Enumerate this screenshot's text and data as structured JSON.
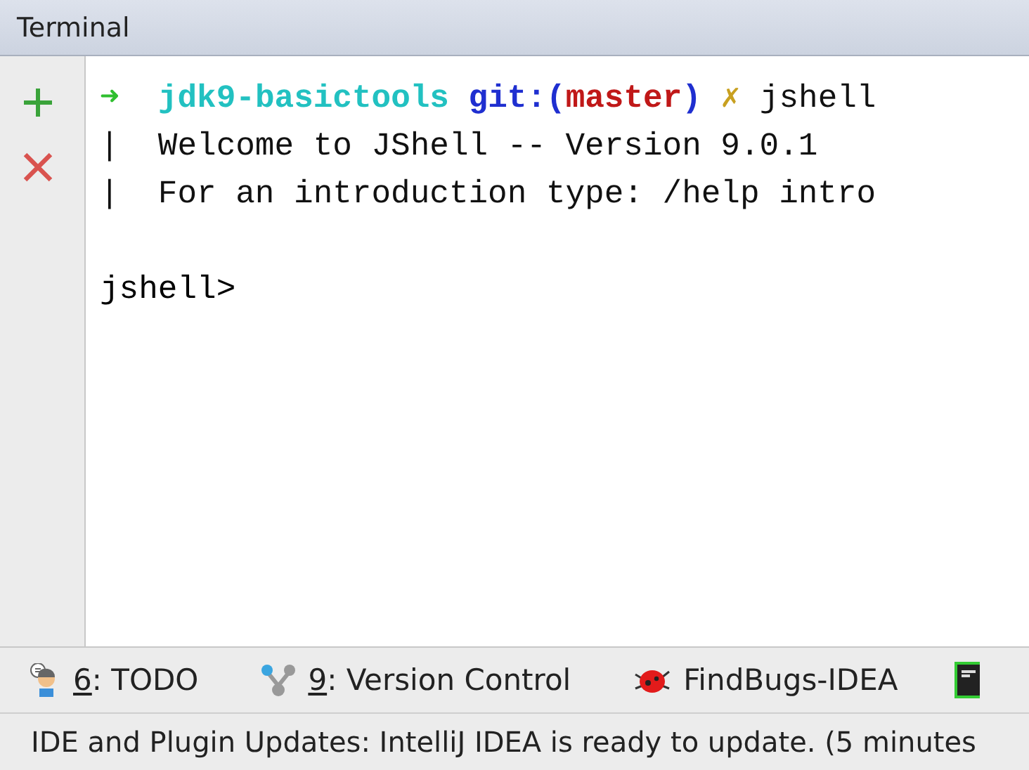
{
  "panel": {
    "title": "Terminal"
  },
  "terminal": {
    "lines": [
      {
        "segments": [
          {
            "kind": "arrow",
            "text": "➜  "
          },
          {
            "kind": "dir",
            "text": "jdk9-basictools "
          },
          {
            "kind": "git",
            "text": "git:("
          },
          {
            "kind": "branch",
            "text": "master"
          },
          {
            "kind": "git",
            "text": ") "
          },
          {
            "kind": "dirty",
            "text": "✗ "
          },
          {
            "kind": "plain",
            "text": "jshell"
          }
        ]
      },
      {
        "segments": [
          {
            "kind": "plain",
            "text": "|  Welcome to JShell -- Version 9.0.1"
          }
        ]
      },
      {
        "segments": [
          {
            "kind": "plain",
            "text": "|  For an introduction type: /help intro"
          }
        ]
      }
    ],
    "prompt": "jshell>"
  },
  "tool_windows": [
    {
      "kind": "todo",
      "mnemonic": "6",
      "label": ": TODO"
    },
    {
      "kind": "vcs",
      "mnemonic": "9",
      "label": ": Version Control"
    },
    {
      "kind": "findbugs",
      "label": "FindBugs-IDEA"
    },
    {
      "kind": "terminal"
    }
  ],
  "status_bar": "IDE and Plugin Updates: IntelliJ IDEA is ready to update. (5 minutes"
}
